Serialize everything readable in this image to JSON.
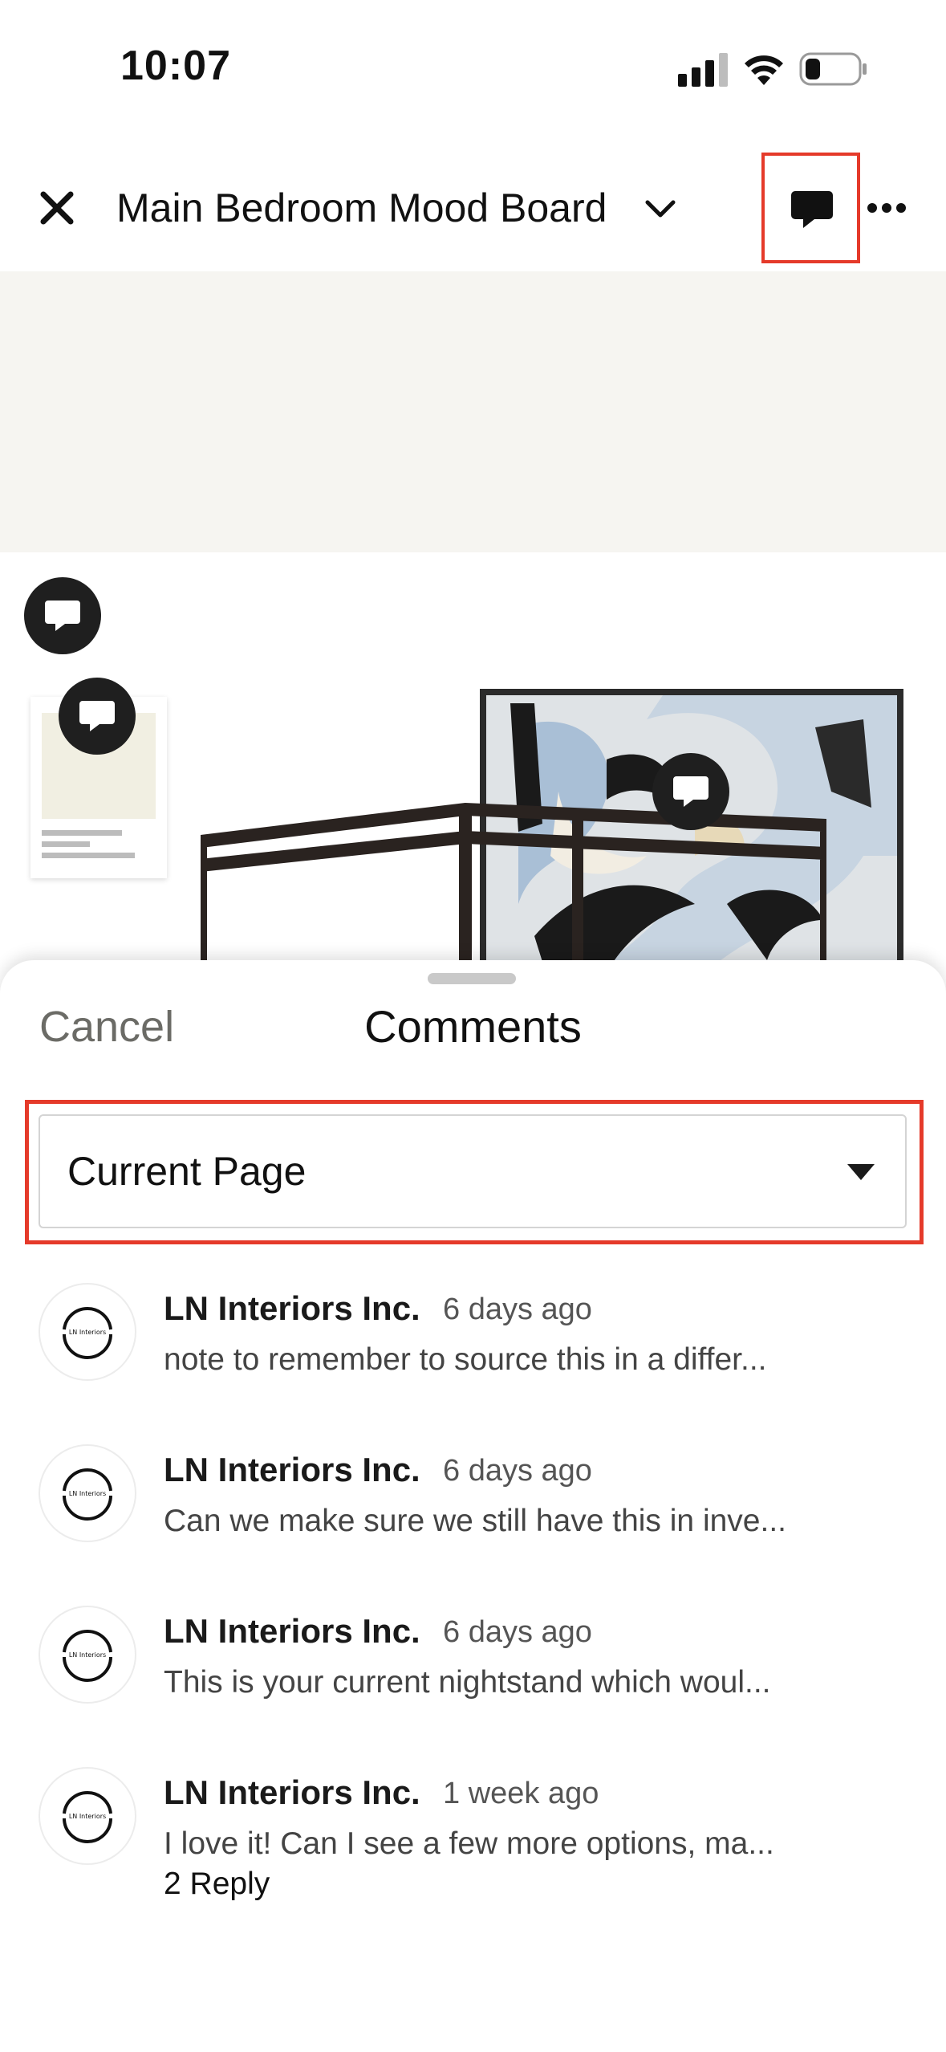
{
  "status_bar": {
    "time": "10:07"
  },
  "header": {
    "title": "Main Bedroom Mood Board"
  },
  "sheet": {
    "cancel_label": "Cancel",
    "title": "Comments",
    "filter": {
      "selected": "Current Page"
    }
  },
  "comments": [
    {
      "author": "LN Interiors Inc.",
      "time": "6 days ago",
      "text": "note to remember to source this in a differ...",
      "avatar_text": "LN Interiors",
      "reply": ""
    },
    {
      "author": "LN Interiors Inc.",
      "time": "6 days ago",
      "text": "Can we make sure we still have this in inve...",
      "avatar_text": "LN Interiors",
      "reply": ""
    },
    {
      "author": "LN Interiors Inc.",
      "time": "6 days ago",
      "text": "This is your current nightstand which woul...",
      "avatar_text": "LN Interiors",
      "reply": ""
    },
    {
      "author": "LN Interiors Inc.",
      "time": "1 week ago",
      "text": "I love it! Can I see a few more options, ma...",
      "avatar_text": "LN Interiors",
      "reply": "2 Reply"
    }
  ],
  "colors": {
    "highlight": "#e53a2a",
    "pin": "#1f1f1f",
    "canvas_bg": "#f6f5f1"
  }
}
